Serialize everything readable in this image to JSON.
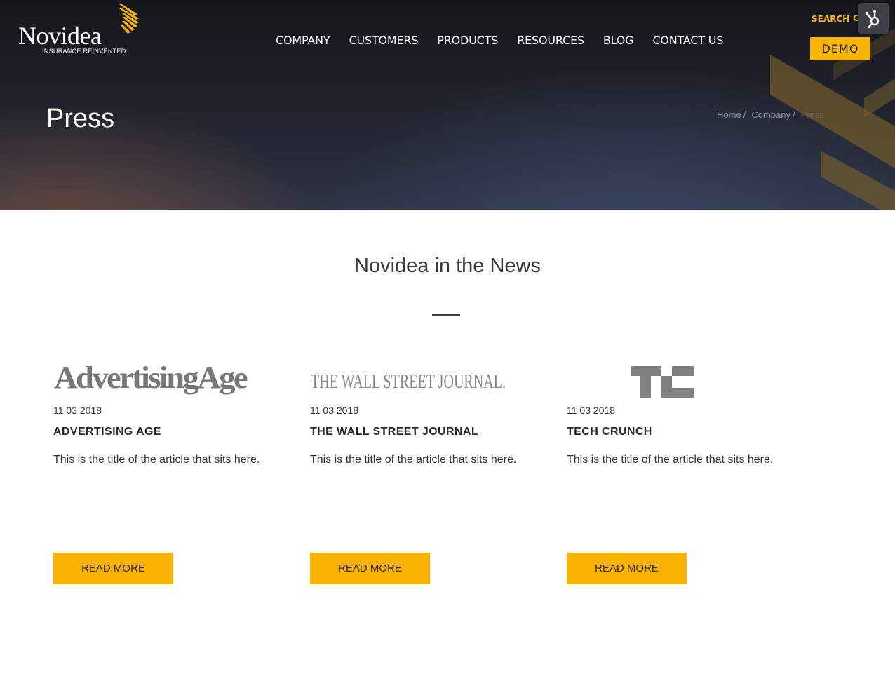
{
  "brand": {
    "name": "Novidea",
    "tagline": "INSURANCE REINVENTED",
    "accent_color": "#f7b500",
    "logo_icon": "wing-stripes-icon"
  },
  "nav": {
    "items": [
      "COMPANY",
      "CUSTOMERS",
      "PRODUCTS",
      "RESOURCES",
      "BLOG",
      "CONTACT US"
    ]
  },
  "header": {
    "search_label": "SEARCH",
    "search_icon_glyph": "C",
    "demo_label": "DEMO",
    "hubspot_icon": "hubspot-sprocket-icon"
  },
  "hero": {
    "page_title": "Press",
    "breadcrumb": [
      "Home",
      "Company",
      "Press"
    ],
    "breadcrumb_separator": "/"
  },
  "section": {
    "title": "Novidea in the News"
  },
  "articles": [
    {
      "logo_text": "AdvertisingAge",
      "date": "11 03 2018",
      "outlet": "ADVERTISING AGE",
      "description": "This is the title of the article that sits here.",
      "button_label": "READ MORE"
    },
    {
      "logo_text": "THE WALL STREET JOURNAL.",
      "date": "11 03 2018",
      "outlet": "THE WALL STREET JOURNAL",
      "description": "This is the title of the article that sits here.",
      "button_label": "READ MORE"
    },
    {
      "logo_text": "",
      "logo_icon": "techcrunch-tc-logo",
      "date": "11 03 2018",
      "outlet": "TECH CRUNCH",
      "description": "This is the title of the article that sits here.",
      "button_label": "READ MORE"
    }
  ]
}
